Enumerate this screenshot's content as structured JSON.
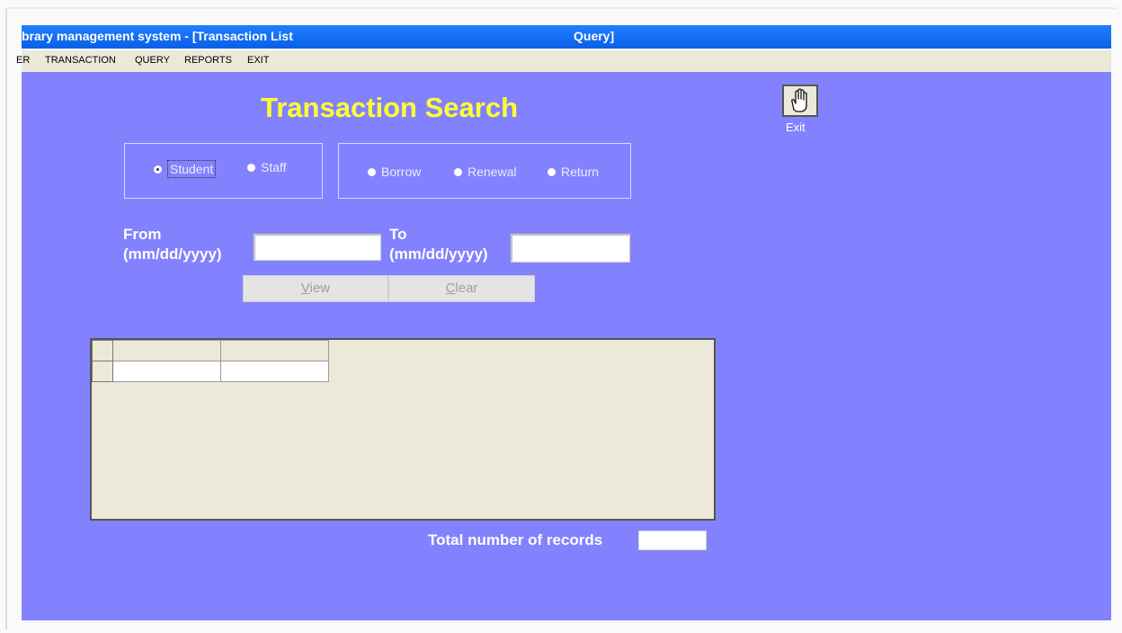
{
  "window": {
    "title_left": "brary management system - [Transaction List",
    "title_right": "Query]"
  },
  "menu": {
    "items": [
      "ER",
      "TRANSACTION",
      "QUERY",
      "REPORTS",
      "EXIT"
    ]
  },
  "form": {
    "heading": "Transaction Search",
    "person_type": {
      "options": [
        "Student",
        "Staff"
      ],
      "selected": "Student"
    },
    "transaction_type": {
      "options": [
        "Borrow",
        "Renewal",
        "Return"
      ]
    },
    "from_label": "From",
    "from_format": "(mm/dd/yyyy)",
    "from_value": "",
    "to_label": "To",
    "to_format": "(mm/dd/yyyy)",
    "to_value": "",
    "view_button": {
      "first": "V",
      "rest": "iew"
    },
    "clear_button": {
      "first": "C",
      "rest": "lear"
    },
    "total_records_label": "Total number of records",
    "total_records_value": "",
    "exit_label": "Exit"
  },
  "colors": {
    "panel_bg": "#8282ff",
    "heading": "#ffff33",
    "titlebar": "#0a5fe6"
  },
  "icons": {
    "exit": "hand-stop-icon"
  }
}
